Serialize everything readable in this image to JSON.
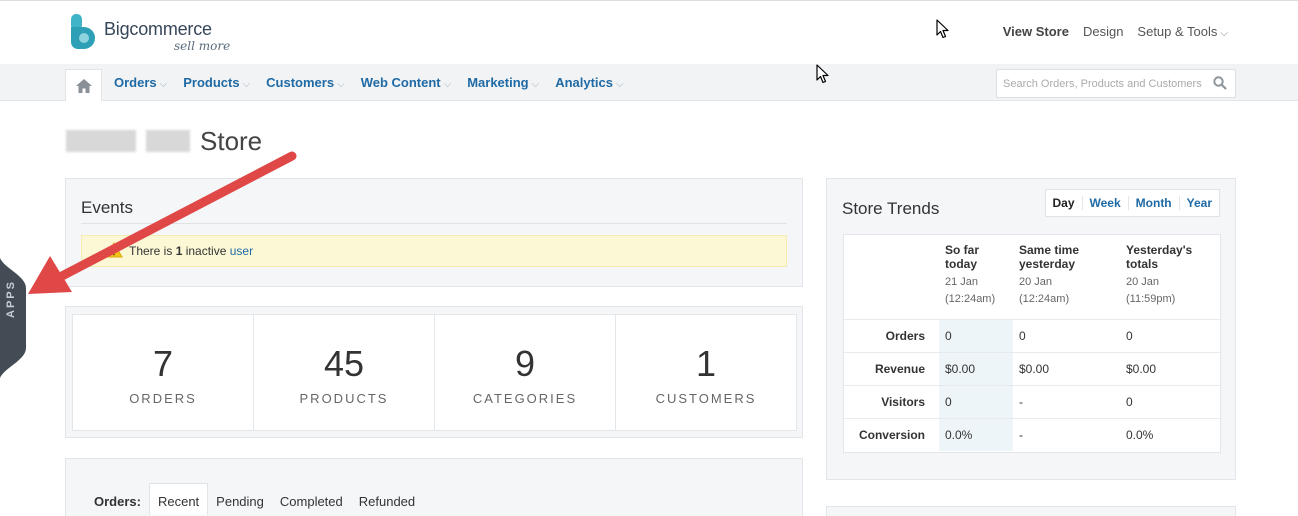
{
  "brand": {
    "name": "Bigcommerce",
    "tagline": "sell more"
  },
  "top_links": {
    "view_store": "View Store",
    "design": "Design",
    "setup_tools": "Setup & Tools",
    "chevron": "⌵"
  },
  "nav": {
    "home_icon": "home-icon",
    "items": [
      {
        "label": "Orders"
      },
      {
        "label": "Products"
      },
      {
        "label": "Customers"
      },
      {
        "label": "Web Content"
      },
      {
        "label": "Marketing"
      },
      {
        "label": "Analytics"
      }
    ],
    "chevron": "⌵",
    "search_placeholder": "Search Orders, Products and Customers"
  },
  "store": {
    "name": "Store"
  },
  "events": {
    "title": "Events",
    "alert_prefix": "There is ",
    "alert_count": "1",
    "alert_middle": " inactive ",
    "alert_link": "user"
  },
  "stats": [
    {
      "value": "7",
      "label": "ORDERS"
    },
    {
      "value": "45",
      "label": "PRODUCTS"
    },
    {
      "value": "9",
      "label": "CATEGORIES"
    },
    {
      "value": "1",
      "label": "CUSTOMERS"
    }
  ],
  "orders": {
    "label": "Orders:",
    "tabs": [
      "Recent",
      "Pending",
      "Completed",
      "Refunded"
    ],
    "active": "Recent"
  },
  "trends": {
    "title": "Store Trends",
    "periods": [
      "Day",
      "Week",
      "Month",
      "Year"
    ],
    "active_period": "Day",
    "columns": [
      {
        "title": "So far today",
        "date": "21 Jan",
        "time": "(12:24am)"
      },
      {
        "title": "Same time yesterday",
        "date": "20 Jan",
        "time": "(12:24am)"
      },
      {
        "title": "Yesterday's totals",
        "date": "20 Jan",
        "time": "(11:59pm)"
      }
    ],
    "rows": [
      {
        "label": "Orders",
        "values": [
          "0",
          "0",
          "0"
        ]
      },
      {
        "label": "Revenue",
        "values": [
          "$0.00",
          "$0.00",
          "$0.00"
        ]
      },
      {
        "label": "Visitors",
        "values": [
          "0",
          "-",
          "0"
        ]
      },
      {
        "label": "Conversion",
        "values": [
          "0.0%",
          "-",
          "0.0%"
        ]
      }
    ]
  },
  "apps_tab": {
    "label": "APPS"
  },
  "colors": {
    "link_blue": "#1f6aa5",
    "arrow_red": "#e04848",
    "apps_tab": "#434c55",
    "logo_teal": "#3fb4c9"
  }
}
